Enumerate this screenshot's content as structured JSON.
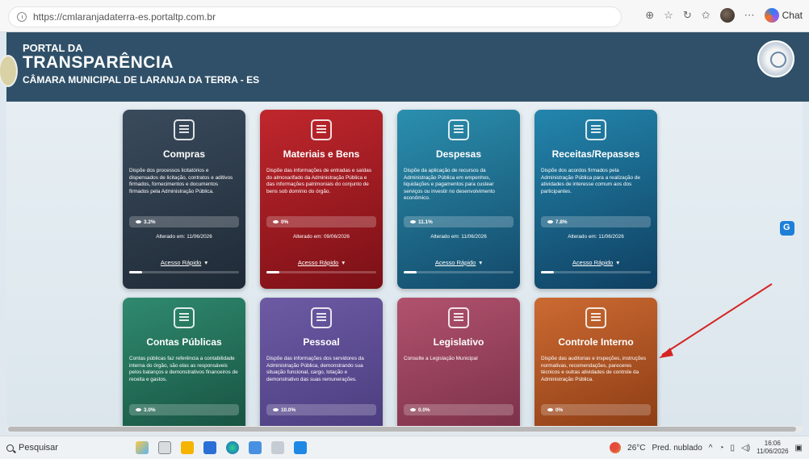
{
  "browser": {
    "url": "https://cmlaranjadaterra-es.portaltp.com.br",
    "chat_label": "Chat",
    "icons": [
      "zoom-icon",
      "favorite-star-icon",
      "refresh-icon",
      "favorites-icon",
      "profile-avatar",
      "more-icon",
      "copilot-icon"
    ]
  },
  "header": {
    "line1": "PORTAL DA",
    "line2": "TRANSPARÊNCIA",
    "line3": "CÂMARA MUNICIPAL DE LARANJA DA TERRA - ES"
  },
  "cards": [
    {
      "title": "Compras",
      "desc": "Dispõe dos processos licitatórios e dispensados de licitação, contratos e aditivos firmados, fornecimentos e documentos firmados pela Administração Pública.",
      "percent": "3.2%",
      "altered": "Alterado em: 11/06/2026",
      "quick": "Acesso Rápido",
      "color": "#2d3a48"
    },
    {
      "title": "Materiais e Bens",
      "desc": "Dispõe das informações de entradas e saídas do almoxarifado da Administração Pública e das informações patrimoniais do conjunto de bens sob domínio do órgão.",
      "percent": "0%",
      "altered": "Alterado em: 09/06/2026",
      "quick": "Acesso Rápido",
      "color": "#a31e24"
    },
    {
      "title": "Despesas",
      "desc": "Dispõe da aplicação de recursos da Administração Pública em empenhos, liquidações e pagamentos para custear serviços ou investir no desenvolvimento econômico.",
      "percent": "11.1%",
      "altered": "Alterado em: 11/06/2026",
      "quick": "Acesso Rápido",
      "color": "#1f6f8f"
    },
    {
      "title": "Receitas/Repasses",
      "desc": "Dispõe dos acordos firmados pela Administração Pública para a realização de atividades de interesse comum aos dos participantes.",
      "percent": "7.8%",
      "altered": "Alterado em: 11/06/2026",
      "quick": "Acesso Rápido",
      "color": "#1a6288"
    },
    {
      "title": "Contas Públicas",
      "desc": "Contas públicas faz referência a contabilidade interna do órgão, são elas as responsáveis pelos balanços e demonstrativos financeiros de receita e gastos.",
      "percent": "3.0%",
      "color": "#236e58"
    },
    {
      "title": "Pessoal",
      "desc": "Dispõe das informações dos servidores da Administração Pública, demonstrando sua situação funcional, cargo, lotação e demonstrativo das suas remunerações.",
      "percent": "10.0%",
      "color": "#5a4a92"
    },
    {
      "title": "Legislativo",
      "desc": "Consulte a Legislação Municipal",
      "percent": "0.0%",
      "color": "#93405b"
    },
    {
      "title": "Controle Interno",
      "desc": "Dispõe das auditorias e inspeções, instruções normativas, recomendações, pareceres técnicos e outras atividades de controle da Administração Pública.",
      "percent": "0%",
      "color": "#ad5222"
    }
  ],
  "taskbar": {
    "search_label": "Pesquisar",
    "weather": "26°C",
    "weather_desc": "Pred. nublado",
    "time": "16:06",
    "date": "11/06/2026"
  }
}
